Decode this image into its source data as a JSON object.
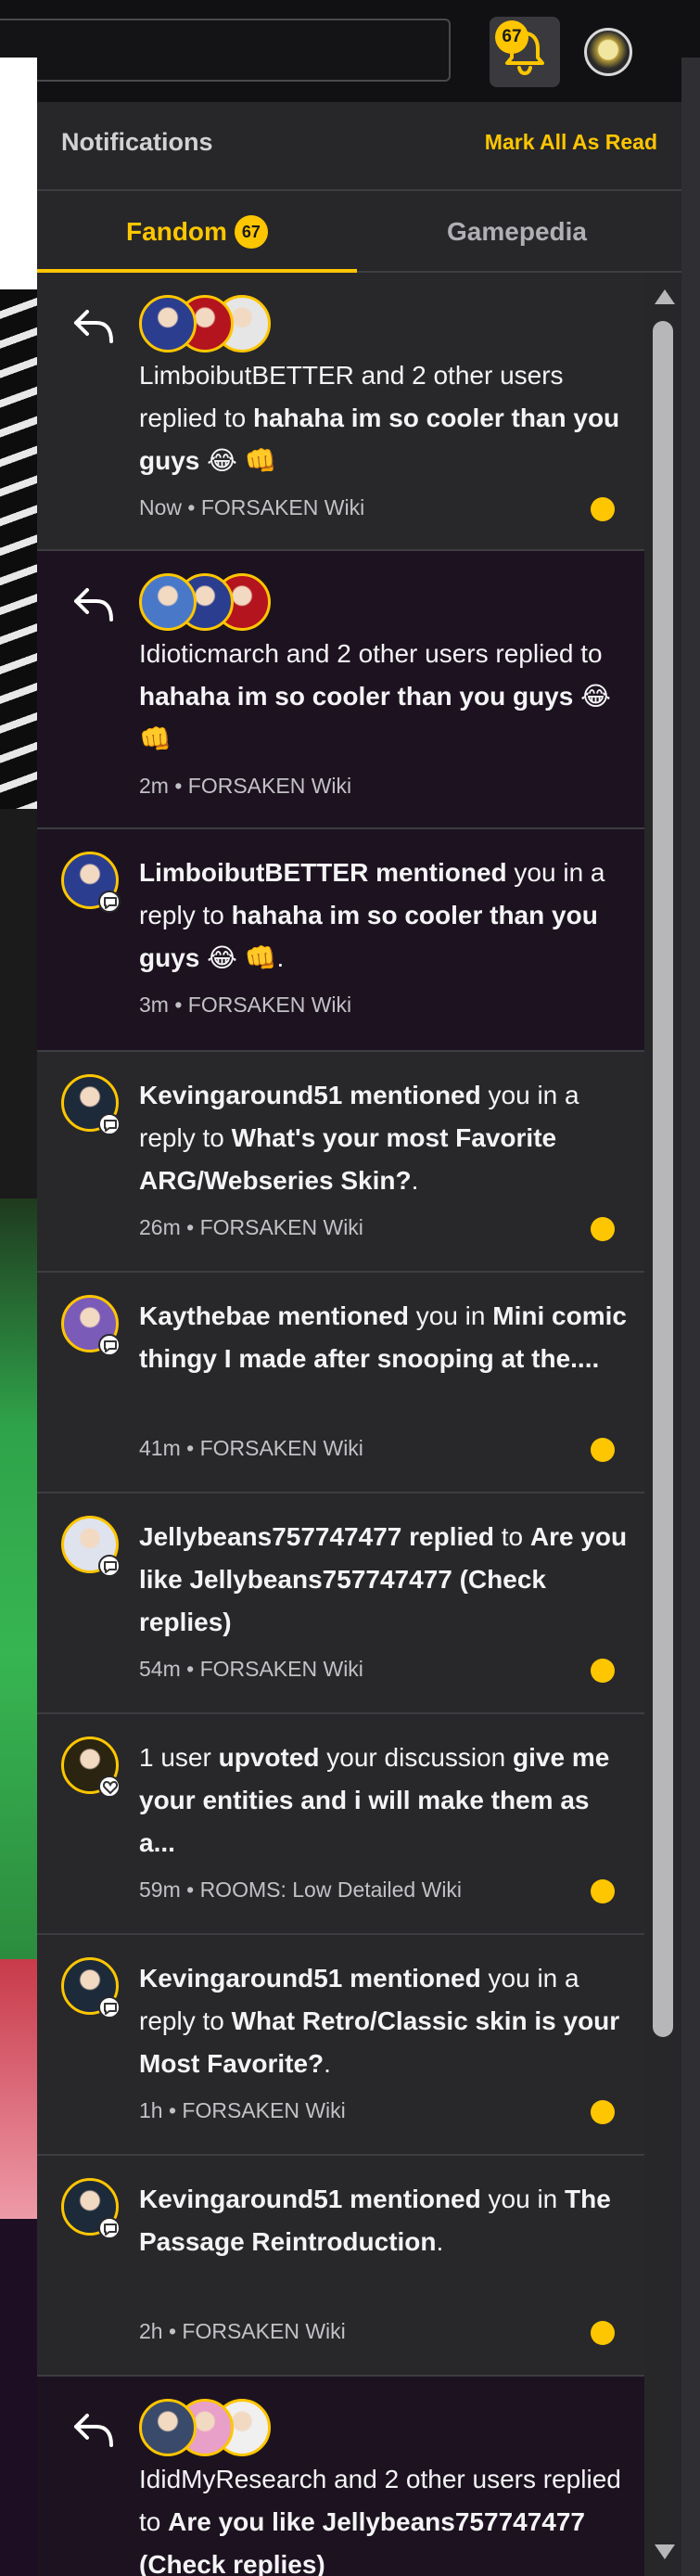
{
  "topbar": {
    "notification_count": "67",
    "colors": {
      "accent": "#fec600"
    }
  },
  "panel": {
    "title": "Notifications",
    "mark_all_label": "Mark All As Read",
    "tabs": [
      {
        "label": "Fandom",
        "badge": "67",
        "selected": true
      },
      {
        "label": "Gamepedia",
        "selected": false
      }
    ]
  },
  "notifications": [
    {
      "status": "unread",
      "kind": "replies",
      "icon": "reply-arrow-icon",
      "parts": [
        {
          "text": "LimboibutBETTER and 2 other users replied to ",
          "bold": false
        },
        {
          "text": "hahaha im so cooler than you guys 😂 👊",
          "bold": true
        }
      ],
      "meta": "Now • FORSAKEN Wiki"
    },
    {
      "status": "read",
      "kind": "replies",
      "icon": "reply-arrow-icon",
      "parts": [
        {
          "text": "Idioticmarch and 2 other users replied to ",
          "bold": false
        },
        {
          "text": "hahaha im so cooler than you guys 😂 👊",
          "bold": true
        }
      ],
      "meta": "2m • FORSAKEN Wiki"
    },
    {
      "status": "read",
      "kind": "mention",
      "parts": [
        {
          "text": "LimboibutBETTER",
          "bold": true
        },
        {
          "text": " mentioned",
          "bold": true
        },
        {
          "text": " you in a reply to ",
          "bold": false
        },
        {
          "text": "hahaha im so cooler than you guys 😂 👊",
          "bold": true
        },
        {
          "text": ".",
          "bold": false
        }
      ],
      "meta": "3m • FORSAKEN Wiki"
    },
    {
      "status": "unread",
      "kind": "mention",
      "parts": [
        {
          "text": "Kevingaround51",
          "bold": true
        },
        {
          "text": " mentioned",
          "bold": true
        },
        {
          "text": " you in a reply to ",
          "bold": false
        },
        {
          "text": "What's your most Favorite ARG/Webseries Skin?",
          "bold": true
        },
        {
          "text": ".",
          "bold": false
        }
      ],
      "meta": "26m • FORSAKEN Wiki"
    },
    {
      "status": "unread",
      "kind": "mention",
      "parts": [
        {
          "text": "Kaythebae",
          "bold": true
        },
        {
          "text": " mentioned",
          "bold": true
        },
        {
          "text": " you in ",
          "bold": false
        },
        {
          "text": "Mini comic thingy I made after snooping at the....",
          "bold": true
        }
      ],
      "meta": "41m • FORSAKEN Wiki"
    },
    {
      "status": "unread",
      "kind": "reply",
      "parts": [
        {
          "text": "Jellybeans757747477",
          "bold": true
        },
        {
          "text": " replied",
          "bold": true
        },
        {
          "text": " to ",
          "bold": false
        },
        {
          "text": "Are you like Jellybeans757747477 (Check replies)",
          "bold": true
        }
      ],
      "meta": "54m • FORSAKEN Wiki"
    },
    {
      "status": "unread",
      "kind": "upvote",
      "parts": [
        {
          "text": "1 user ",
          "bold": false
        },
        {
          "text": "upvoted",
          "bold": true
        },
        {
          "text": " your discussion ",
          "bold": false
        },
        {
          "text": "give me your entities and i will make them as a...",
          "bold": true
        }
      ],
      "meta": "59m • ROOMS: Low Detailed Wiki"
    },
    {
      "status": "unread",
      "kind": "mention",
      "parts": [
        {
          "text": "Kevingaround51",
          "bold": true
        },
        {
          "text": " mentioned",
          "bold": true
        },
        {
          "text": " you in a reply to ",
          "bold": false
        },
        {
          "text": "What Retro/Classic skin is your Most Favorite?",
          "bold": true
        },
        {
          "text": ".",
          "bold": false
        }
      ],
      "meta": "1h • FORSAKEN Wiki"
    },
    {
      "status": "unread",
      "kind": "mention",
      "parts": [
        {
          "text": "Kevingaround51",
          "bold": true
        },
        {
          "text": " mentioned",
          "bold": true
        },
        {
          "text": " you in ",
          "bold": false
        },
        {
          "text": "The Passage Reintroduction",
          "bold": true
        },
        {
          "text": ".",
          "bold": false
        }
      ],
      "meta": "2h • FORSAKEN Wiki"
    },
    {
      "status": "read",
      "kind": "replies",
      "icon": "reply-arrow-icon",
      "parts": [
        {
          "text": "IdidMyResearch and 2 other users replied to ",
          "bold": false
        },
        {
          "text": "Are you like Jellybeans757747477 (Check replies)",
          "bold": true
        }
      ],
      "meta": ""
    }
  ]
}
